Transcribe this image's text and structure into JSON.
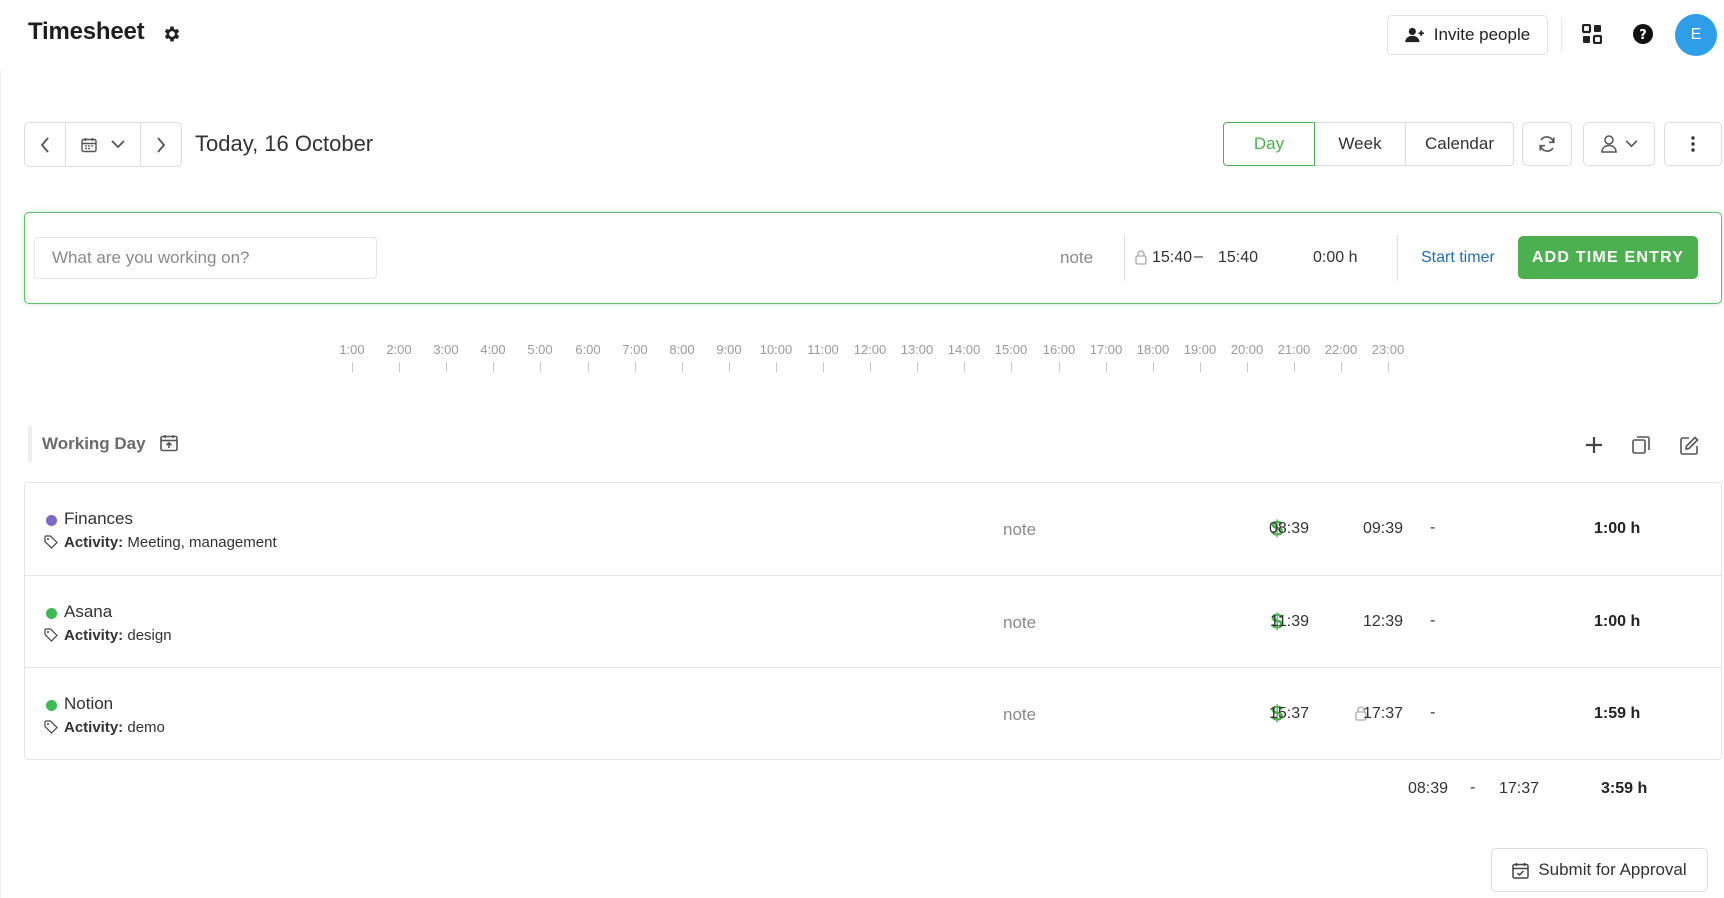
{
  "header": {
    "title": "Timesheet",
    "invite_label": "Invite people",
    "avatar_initial": "E",
    "avatar_color": "#2f9ee8"
  },
  "toolbar": {
    "date_label": "Today, 16 October",
    "views": [
      "Day",
      "Week",
      "Calendar"
    ],
    "active_view": "Day"
  },
  "entry": {
    "placeholder": "What are you working on?",
    "note_label": "note",
    "start": "15:40",
    "dash": "–",
    "end": "15:40",
    "duration": "0:00 h",
    "start_timer_label": "Start timer",
    "add_button_label": "ADD TIME ENTRY"
  },
  "timeline": {
    "hours": [
      "1:00",
      "2:00",
      "3:00",
      "4:00",
      "5:00",
      "6:00",
      "7:00",
      "8:00",
      "9:00",
      "10:00",
      "11:00",
      "12:00",
      "13:00",
      "14:00",
      "15:00",
      "16:00",
      "17:00",
      "18:00",
      "19:00",
      "20:00",
      "21:00",
      "22:00",
      "23:00"
    ]
  },
  "working_day": {
    "label": "Working Day",
    "entries": [
      {
        "project": "Finances",
        "color": "#7b68c9",
        "activity_label": "Activity:",
        "activity": "Meeting, management",
        "note": "note",
        "billable": "$",
        "locked": false,
        "start": "08:39",
        "dash": "-",
        "end": "09:39",
        "duration": "1:00 h"
      },
      {
        "project": "Asana",
        "color": "#3cba54",
        "activity_label": "Activity:",
        "activity": "design",
        "note": "note",
        "billable": "$",
        "locked": false,
        "start": "11:39",
        "dash": "-",
        "end": "12:39",
        "duration": "1:00 h"
      },
      {
        "project": "Notion",
        "color": "#3cba54",
        "activity_label": "Activity:",
        "activity": "demo",
        "note": "note",
        "billable": "$",
        "locked": true,
        "start": "15:37",
        "dash": "-",
        "end": "17:37",
        "duration": "1:59 h"
      }
    ],
    "totals": {
      "start": "08:39",
      "dash": "-",
      "end": "17:37",
      "duration": "3:59 h"
    }
  },
  "footer": {
    "submit_label": "Submit for Approval"
  },
  "colors": {
    "accent": "#4caf50",
    "link": "#1e6fbf"
  }
}
